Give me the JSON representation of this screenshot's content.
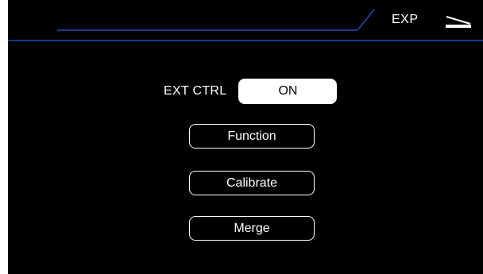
{
  "header": {
    "mode_label": "EXP",
    "mode_icon": "expression-pedal-icon",
    "accent_color": "#1f4fb3"
  },
  "ext_ctrl": {
    "label": "EXT CTRL",
    "value": "ON"
  },
  "menu": {
    "function_label": "Function",
    "calibrate_label": "Calibrate",
    "merge_label": "Merge"
  }
}
